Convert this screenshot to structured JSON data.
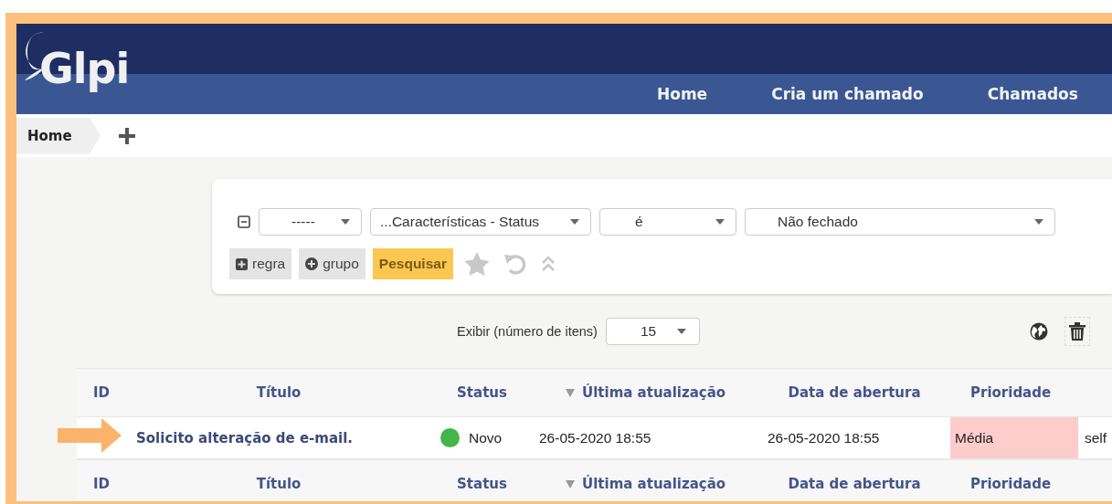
{
  "header": {
    "logo": "Glpi",
    "nav": [
      {
        "label": "Home"
      },
      {
        "label": "Cria um chamado"
      },
      {
        "label": "Chamados"
      }
    ]
  },
  "breadcrumb": {
    "items": [
      "Home"
    ]
  },
  "search": {
    "criteria": [
      {
        "link": "-----",
        "field": "...Características - Status",
        "operator": "é",
        "value": "Não fechado"
      }
    ],
    "buttons": [
      {
        "label": "regra",
        "kind": "rule"
      },
      {
        "label": "grupo",
        "kind": "group"
      },
      {
        "label": "Pesquisar",
        "kind": "submit"
      }
    ]
  },
  "display": {
    "label": "Exibir (número de itens)",
    "value": "15"
  },
  "table": {
    "columns": [
      {
        "label": "ID",
        "sorted": false
      },
      {
        "label": "Título",
        "sorted": false
      },
      {
        "label": "Status",
        "sorted": false
      },
      {
        "label": "Última atualização",
        "sorted": true
      },
      {
        "label": "Data de abertura",
        "sorted": false
      },
      {
        "label": "Prioridade",
        "sorted": false
      }
    ],
    "rows": [
      {
        "title": "Solicito alteração de e-mail.",
        "status": {
          "label": "Novo",
          "color": "#43b549"
        },
        "last_update": "26-05-2020 18:55",
        "opened": "26-05-2020 18:55",
        "priority": {
          "label": "Média",
          "color": "#ffcccc"
        },
        "column_7": "self"
      }
    ],
    "footer_columns": [
      {
        "label": "ID",
        "sorted": false
      },
      {
        "label": "Título",
        "sorted": false
      },
      {
        "label": "Status",
        "sorted": false
      },
      {
        "label": "Última atualização",
        "sorted": true
      },
      {
        "label": "Data de abertura",
        "sorted": false
      },
      {
        "label": "Prioridade",
        "sorted": false
      }
    ]
  }
}
